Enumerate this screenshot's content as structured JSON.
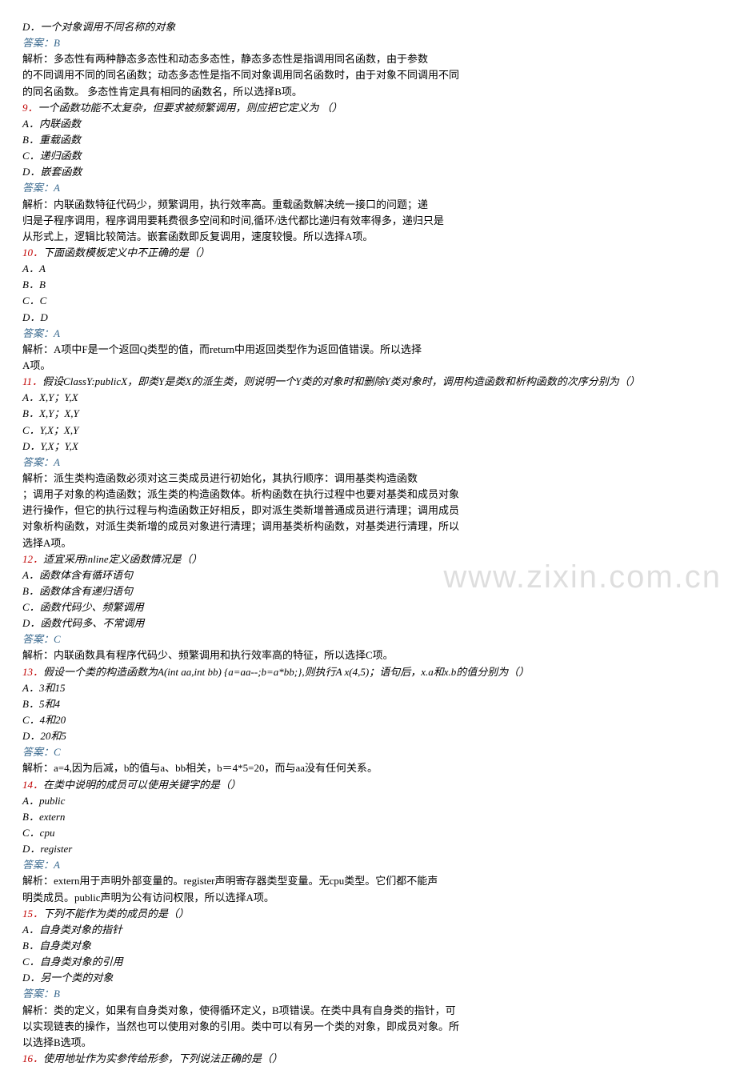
{
  "watermark": "www.zixin.com.cn",
  "q8": {
    "option_d": "D．一个对象调用不同名称的对象",
    "answer": "答案：B",
    "explain": [
      "解析：多态性有两种静态多态性和动态多态性，静态多态性是指调用同名函数，由于参数",
      "的不同调用不同的同名函数；动态多态性是指不同对象调用同名函数时，由于对象不同调用不同",
      "的同名函数。 多态性肯定具有相同的函数名，所以选择B项。"
    ]
  },
  "q9": {
    "num": "9．",
    "stem": "一个函数功能不太复杂，但要求被频繁调用，则应把它定义为 （）",
    "options": {
      "a": "A．内联函数",
      "b": "B．重载函数",
      "c": "C．递归函数",
      "d": "D．嵌套函数"
    },
    "answer": "答案：A",
    "explain": [
      "解析：内联函数特征代码少，频繁调用，执行效率高。重载函数解决统一接口的问题；递",
      "归是子程序调用，程序调用要耗费很多空间和时间,循环/迭代都比递归有效率得多，递归只是",
      "从形式上，逻辑比较简洁。嵌套函数即反复调用，速度较慢。所以选择A项。"
    ]
  },
  "q10": {
    "num": "10．",
    "stem": "下面函数模板定义中不正确的是（）",
    "options": {
      "a": "A．A",
      "b": "B．B",
      "c": "C．C",
      "d": "D．D"
    },
    "answer": "答案：A",
    "explain": [
      "解析：A项中F是一个返回Q类型的值，而return中用返回类型作为返回值错误。所以选择",
      "A项。"
    ]
  },
  "q11": {
    "num": "11．",
    "stem": "假设ClassY:publicX，即类Y是类X的派生类，则说明一个Y类的对象时和删除Y类对象时，调用构造函数和析构函数的次序分别为（）",
    "options": {
      "a": "A．X,Y；Y,X",
      "b": "B．X,Y；X,Y",
      "c": "C．Y,X；X,Y",
      "d": "D．Y,X；Y,X"
    },
    "answer": "答案：A",
    "explain": [
      "解析：派生类构造函数必须对这三类成员进行初始化，其执行顺序：调用基类构造函数",
      "；调用子对象的构造函数；派生类的构造函数体。析构函数在执行过程中也要对基类和成员对象",
      "进行操作，但它的执行过程与构造函数正好相反，即对派生类新增普通成员进行清理；调用成员",
      "对象析构函数，对派生类新增的成员对象进行清理；调用基类析构函数，对基类进行清理，所以",
      "选择A项。"
    ]
  },
  "q12": {
    "num": "12．",
    "stem": "适宜采用inline定义函数情况是（）",
    "options": {
      "a": "A．函数体含有循环语句",
      "b": "B．函数体含有递归语句",
      "c": "C．函数代码少、频繁调用",
      "d": "D．函数代码多、不常调用"
    },
    "answer": "答案：C",
    "explain": [
      "解析：内联函数具有程序代码少、频繁调用和执行效率高的特征，所以选择C项。"
    ]
  },
  "q13": {
    "num": "13．",
    "stem": "假设一个类的构造函数为A(int aa,int bb) {a=aa--;b=a*bb;},则执行A x(4,5)；语句后，x.a和x.b的值分别为（）",
    "options": {
      "a": "A．3和15",
      "b": "B．5和4",
      "c": "C．4和20",
      "d": "D．20和5"
    },
    "answer": "答案：C",
    "explain": [
      "解析：a=4,因为后减，b的值与a、bb相关，b＝4*5=20，而与aa没有任何关系。"
    ]
  },
  "q14": {
    "num": "14．",
    "stem": "在类中说明的成员可以使用关键字的是（）",
    "options": {
      "a": "A．public",
      "b": "B．extern",
      "c": "C．cpu",
      "d": "D．register"
    },
    "answer": "答案：A",
    "explain": [
      "解析：extern用于声明外部变量的。register声明寄存器类型变量。无cpu类型。它们都不能声",
      "明类成员。public声明为公有访问权限，所以选择A项。"
    ]
  },
  "q15": {
    "num": "15．",
    "stem": "下列不能作为类的成员的是（）",
    "options": {
      "a": "A．自身类对象的指针",
      "b": "B．自身类对象",
      "c": "C．自身类对象的引用",
      "d": "D．另一个类的对象"
    },
    "answer": "答案：B",
    "explain": [
      "解析：类的定义，如果有自身类对象，使得循环定义，B项错误。在类中具有自身类的指针，可",
      "以实现链表的操作，当然也可以使用对象的引用。类中可以有另一个类的对象，即成员对象。所",
      "以选择B选项。"
    ]
  },
  "q16": {
    "num": "16．",
    "stem": "使用地址作为实参传给形参，下列说法正确的是（）"
  }
}
